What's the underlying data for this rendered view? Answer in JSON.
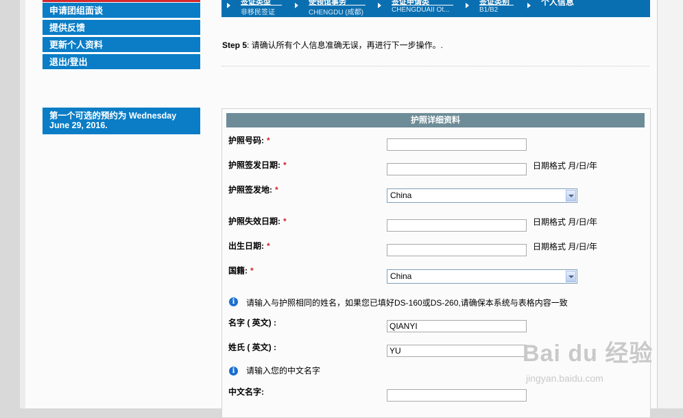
{
  "sidebar": {
    "items": [
      {
        "label": "申请团组面谈"
      },
      {
        "label": "提供反馈"
      },
      {
        "label": "更新个人资料"
      },
      {
        "label": "退出/登出"
      }
    ],
    "first_available_line1": "第一个可选的预约为  Wednesday",
    "first_available_line2": "June 29, 2016."
  },
  "breadcrumb": {
    "items": [
      {
        "title": "签证类型",
        "subtitle": "非移民签证"
      },
      {
        "title": "使领馆事务",
        "subtitle": "CHENGDU (成都)"
      },
      {
        "title": "签证申请类",
        "subtitle": "CHENGDUAII Ot..."
      },
      {
        "title": "签证类别",
        "subtitle": "B1/B2"
      },
      {
        "title": "个人信息",
        "subtitle": ""
      }
    ]
  },
  "step": {
    "prefix": "Step 5",
    "text": ": 请确认所有个人信息准确无误，再进行下一步操作。."
  },
  "form": {
    "title": "护照详细资料",
    "required_mark": "*",
    "date_hint": "日期格式  月/日/年",
    "passport_number": {
      "label": "护照号码:",
      "value": ""
    },
    "issue_date": {
      "label": "护照签发日期:",
      "value": ""
    },
    "issue_place": {
      "label": "护照签发地:",
      "value": "China"
    },
    "expiry_date": {
      "label": "护照失效日期:",
      "value": ""
    },
    "birth_date": {
      "label": "出生日期:",
      "value": ""
    },
    "nationality": {
      "label": "国籍:",
      "value": "China"
    },
    "note_name": "请输入与护照相同的姓名，如果您已填好DS-160或DS-260,请确保本系统与表格内容一致",
    "given_name": {
      "label": "名字  ( 英文) :",
      "value": "QIANYI"
    },
    "surname": {
      "label": "姓氏  ( 英文) :",
      "value": "YU"
    },
    "note_chinese": "请输入您的中文名字",
    "chinese_name": {
      "label": "中文名字:",
      "value": ""
    }
  },
  "watermark": {
    "brand": "Bai du 经验",
    "url": "jingyan.baidu.com"
  }
}
